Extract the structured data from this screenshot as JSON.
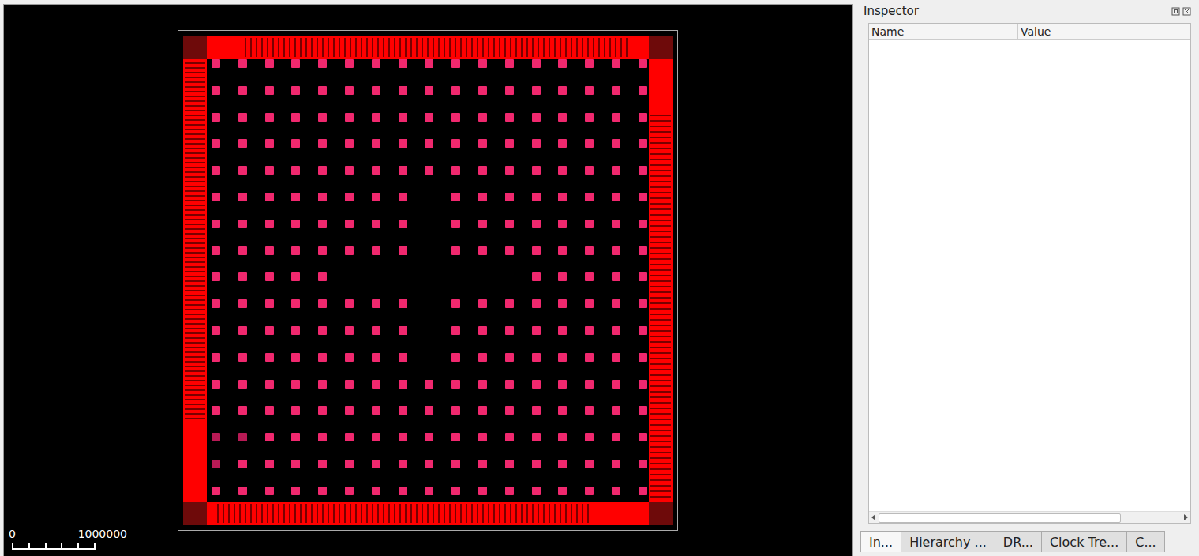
{
  "canvas": {
    "scale": {
      "start": "0",
      "end": "1000000"
    },
    "bump_rows": [
      [
        "bump",
        "bump",
        "bump",
        "bump",
        "bump",
        "bump",
        "bump",
        "bump",
        "bump",
        "bump",
        "bump",
        "bump",
        "bump",
        "bump",
        "bump",
        "bump",
        "bump"
      ],
      [
        "bump",
        "bump",
        "bump",
        "bump",
        "bump",
        "bump",
        "bump",
        "bump",
        "bump",
        "bump",
        "bump",
        "bump",
        "bump",
        "bump",
        "bump",
        "bump",
        "bump"
      ],
      [
        "bump",
        "bump",
        "bump",
        "bump",
        "bump",
        "bump",
        "bump",
        "bump",
        "bump",
        "bump",
        "bump",
        "bump",
        "bump",
        "bump",
        "bump",
        "bump",
        "bump"
      ],
      [
        "bump",
        "bump",
        "bump",
        "bump",
        "bump",
        "bump",
        "bump",
        "bump",
        "bump",
        "bump",
        "bump",
        "bump",
        "bump",
        "bump",
        "bump",
        "bump",
        "bump"
      ],
      [
        "bump",
        "bump",
        "bump",
        "bump",
        "bump",
        "bump",
        "bump",
        "bump",
        "bump",
        "bump",
        "bump",
        "bump",
        "bump",
        "bump",
        "bump",
        "bump",
        "bump"
      ],
      [
        "bump",
        "bump",
        "bump",
        "bump",
        "bump",
        "bump",
        "bump",
        "bump",
        "none",
        "bump",
        "bump",
        "bump",
        "bump",
        "bump",
        "bump",
        "bump",
        "bump"
      ],
      [
        "bump",
        "bump",
        "bump",
        "bump",
        "bump",
        "bump",
        "bump",
        "bump",
        "none",
        "bump",
        "bump",
        "bump",
        "bump",
        "bump",
        "bump",
        "bump",
        "bump"
      ],
      [
        "bump",
        "bump",
        "bump",
        "bump",
        "bump",
        "bump",
        "bump",
        "bump",
        "none",
        "bump",
        "bump",
        "bump",
        "bump",
        "bump",
        "bump",
        "bump",
        "bump"
      ],
      [
        "bump",
        "bump",
        "bump",
        "bump",
        "bump",
        "none",
        "none",
        "none",
        "none",
        "none",
        "none",
        "none",
        "bump",
        "bump",
        "bump",
        "bump",
        "bump"
      ],
      [
        "bump",
        "bump",
        "bump",
        "bump",
        "bump",
        "bump",
        "bump",
        "bump",
        "none",
        "bump",
        "bump",
        "bump",
        "bump",
        "bump",
        "bump",
        "bump",
        "bump"
      ],
      [
        "bump",
        "bump",
        "bump",
        "bump",
        "bump",
        "bump",
        "bump",
        "bump",
        "none",
        "bump",
        "bump",
        "bump",
        "bump",
        "bump",
        "bump",
        "bump",
        "bump"
      ],
      [
        "bump",
        "bump",
        "bump",
        "bump",
        "bump",
        "bump",
        "bump",
        "bump",
        "none",
        "bump",
        "bump",
        "bump",
        "bump",
        "bump",
        "bump",
        "bump",
        "bump"
      ],
      [
        "bump",
        "bump",
        "bump",
        "bump",
        "bump",
        "bump",
        "bump",
        "bump",
        "bump",
        "bump",
        "bump",
        "bump",
        "bump",
        "bump",
        "bump",
        "bump",
        "bump"
      ],
      [
        "bump",
        "bump",
        "bump",
        "bump",
        "bump",
        "bump",
        "bump",
        "bump",
        "bump",
        "bump",
        "bump",
        "bump",
        "bump",
        "bump",
        "bump",
        "bump",
        "bump"
      ],
      [
        "dim",
        "dim",
        "bump",
        "bump",
        "bump",
        "bump",
        "bump",
        "bump",
        "bump",
        "bump",
        "bump",
        "bump",
        "bump",
        "bump",
        "bump",
        "bump",
        "bump"
      ],
      [
        "dim",
        "bump",
        "bump",
        "bump",
        "bump",
        "bump",
        "bump",
        "bump",
        "bump",
        "bump",
        "bump",
        "bump",
        "bump",
        "bump",
        "bump",
        "bump",
        "bump"
      ],
      [
        "bump",
        "bump",
        "bump",
        "bump",
        "bump",
        "bump",
        "bump",
        "bump",
        "bump",
        "bump",
        "bump",
        "bump",
        "bump",
        "bump",
        "bump",
        "bump",
        "bump"
      ]
    ]
  },
  "inspector": {
    "title": "Inspector",
    "columns": [
      "Name",
      "Value"
    ],
    "rows": []
  },
  "tabs": [
    {
      "label": "In...",
      "selected": true
    },
    {
      "label": "Hierarchy ...",
      "selected": false
    },
    {
      "label": "DR...",
      "selected": false
    },
    {
      "label": "Clock Tre...",
      "selected": false
    },
    {
      "label": "C...",
      "selected": false
    }
  ]
}
